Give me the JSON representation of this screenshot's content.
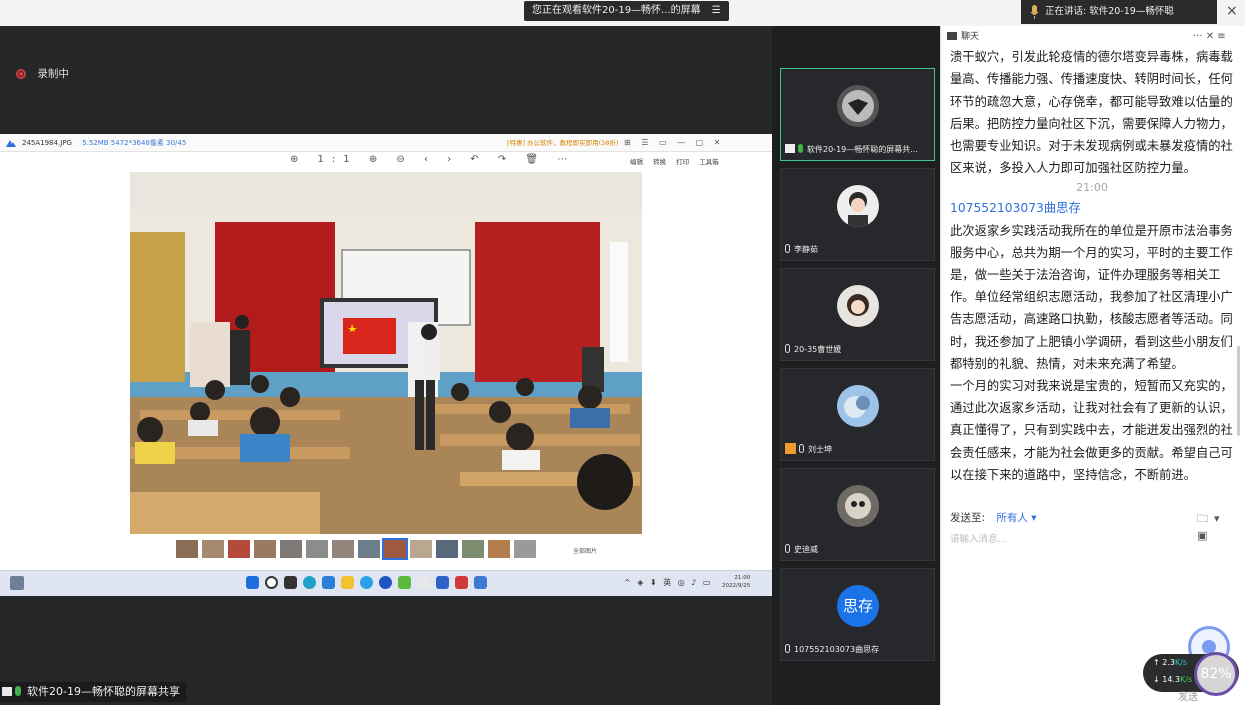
{
  "top": {
    "banner": "您正在观看软件20-19—畅怀...的屏幕",
    "banner_icon": "menu-icon",
    "speaking": "正在讲话: 软件20-19—畅怀聪",
    "close": "×"
  },
  "main": {
    "recording": "录制中",
    "viewer": {
      "filename": "245A1984.JPG",
      "meta": "5.52MB  5472*3648像素  30/45",
      "promo": "[特惠] 办公软件，教程即买即用(38折)",
      "window_buttons": "⊞ ☰ ▭ — ▢ ✕",
      "tools": "⊕ 1:1 ⊕ ⊖ ‹ › ↶ ↷ 🗑 ⋯",
      "right_tools": "编辑 转换 打印 工具箱",
      "all_pictures": "全部图片",
      "tray": "^ ◈ ⬇ 英 ◎ ♪ ▭",
      "clock_time": "21:00",
      "clock_date": "2022/9/25"
    },
    "share_label": "软件20-19—畅怀聪的屏幕共享"
  },
  "participants": [
    {
      "name": "软件20-19—畅怀聪的屏幕共...",
      "kind": "screen",
      "avatar": "superman"
    },
    {
      "name": "李静茹",
      "kind": "mic",
      "avatar": "girl1"
    },
    {
      "name": "20-35曹世媛",
      "kind": "mic",
      "avatar": "girl2"
    },
    {
      "name": "刘士坤",
      "kind": "host",
      "avatar": "landscape"
    },
    {
      "name": "史迪威",
      "kind": "mic",
      "avatar": "dog"
    },
    {
      "name": "107552103073曲思存",
      "kind": "mic",
      "avatar_text": "思存"
    }
  ],
  "chat": {
    "title": "聊天",
    "controls": "··· ✕ ≡",
    "msg1": "，一月三笑，应该着力打造，要求开，一个盘之地，溃干蚁穴，引发此轮疫情的德尔塔变异毒株，病毒载量高、传播能力强、传播速度快、转阴时间长，任何环节的疏忽大意，心存侥幸，都可能导致难以估量的后果。把防控力量向社区下沉，需要保障人力物力，也需要专业知识。对于未发现病例或未暴发疫情的社区来说，多投入人力即可加强社区防控力量。",
    "time": "21:00",
    "sender": "107552103073曲思存",
    "msg2": "此次返家乡实践活动我所在的单位是开原市法治事务服务中心，总共为期一个月的实习，平时的主要工作是，做一些关于法治咨询，证件办理服务等相关工作。单位经常组织志愿活动，我参加了社区清理小广告志愿活动，高速路口执勤，核酸志愿者等活动。同时，我还参加了上肥镇小学调研，看到这些小朋友们都特别的礼貌、热情，对未来充满了希望。",
    "msg3": "一个月的实习对我来说是宝贵的，短暂而又充实的，通过此次返家乡活动，让我对社会有了更新的认识，真正懂得了，只有到实践中去，才能迸发出强烈的社会责任感来，才能为社会做更多的贡献。希望自己可以在接下来的道路中，坚持信念，不断前进。",
    "send_to_label": "发送至:",
    "send_to_value": "所有人 ▾",
    "send_icons": "🗀▾ ▣",
    "placeholder": "请输入消息..."
  },
  "net": {
    "up_value": "2.3",
    "up_unit": "K/s",
    "down_value": "14.3",
    "down_unit": "K/s",
    "percent": "82%",
    "send_ghost": "发送"
  }
}
